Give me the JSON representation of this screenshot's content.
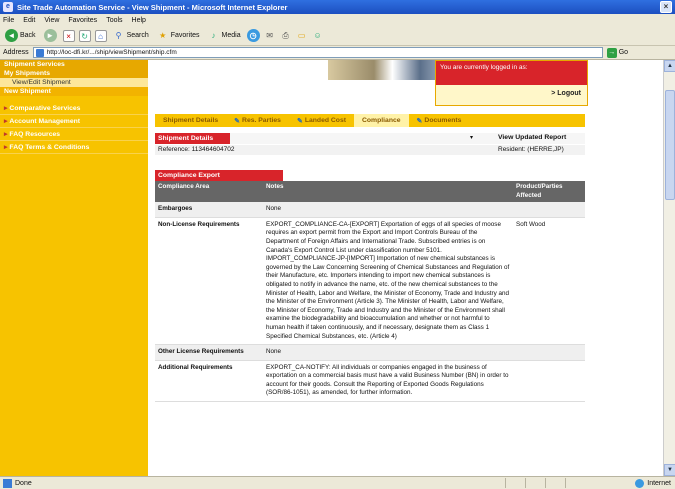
{
  "window": {
    "title": "Site Trade Automation Service - View Shipment - Microsoft Internet Explorer",
    "menu": [
      "File",
      "Edit",
      "View",
      "Favorites",
      "Tools",
      "Help"
    ],
    "toolbar": {
      "back": "Back",
      "search": "Search",
      "favorites": "Favorites",
      "media": "Media"
    },
    "address_label": "Address",
    "address_url": "http://loc-dfi.kr/.../ship/viewShipment/ship.cfm",
    "go_label": "Go",
    "status_text": "Done",
    "zone_text": "Internet"
  },
  "sidebar": {
    "section_title": "Shipment Services",
    "my_shipments": "My Shipments",
    "view_edit": "View/Edit Shipment",
    "new_shipment": "New Shipment",
    "items": [
      "Comparative Services",
      "Account Management",
      "FAQ Resources",
      "FAQ Terms & Conditions"
    ]
  },
  "login": {
    "message": "You are currently logged in as:",
    "logout": "> Logout"
  },
  "tabs": [
    {
      "label": "Shipment Details",
      "pen": false,
      "active": false
    },
    {
      "label": "Res. Parties",
      "pen": true,
      "active": false
    },
    {
      "label": "Landed Cost",
      "pen": true,
      "active": false
    },
    {
      "label": "Compliance",
      "pen": false,
      "active": true
    },
    {
      "label": "Documents",
      "pen": true,
      "active": false
    }
  ],
  "shipment": {
    "header": "Shipment Details",
    "view_report": "View Updated Report",
    "reference_label": "Reference:",
    "reference_value": "113464604702",
    "resident_label": "Resident:",
    "resident_value": "(HERRE,JP)"
  },
  "compliance": {
    "header": "Compliance Export",
    "columns": [
      "Compliance Area",
      "Notes",
      "Product/Parties Affected"
    ],
    "rows": [
      {
        "area": "Embargoes",
        "notes": [
          "None"
        ],
        "affected": ""
      },
      {
        "area": "Non-License Requirements",
        "notes": [
          "EXPORT_COMPLIANCE-CA-[EXPORT] Exportation of eggs of all species of moose requires an export permit from the Export and Import Controls Bureau of the Department of Foreign Affairs and International Trade. Subscribed entries is on Canada's Export Control List under classification number 5101.",
          "IMPORT_COMPLIANCE-JP-[IMPORT] Importation of new chemical substances is governed by the Law Concerning Screening of Chemical Substances and Regulation of their Manufacture, etc. Importers intending to import new chemical substances is obligated to notify in advance the name, etc. of the new chemical substances to the Minister of Health, Labor and Welfare, the Minister of Economy, Trade and Industry and the Minister of the Environment (Article 3). The Minister of Health, Labor and Welfare, the Minister of Economy, Trade and Industry and the Minister of the Environment shall examine the biodegradability and bioaccumulation and whether or not harmful to human health if taken continuously, and if necessary, designate them as Class 1 Specified Chemical Substances, etc. (Article 4)"
        ],
        "affected": "Soft Wood"
      },
      {
        "area": "Other License Requirements",
        "notes": [
          "None"
        ],
        "affected": ""
      },
      {
        "area": "Additional Requirements",
        "notes": [
          "EXPORT_CA-NOTIFY: All individuals or companies engaged in the business of exportation on a commercial basis must have a valid Business Number (BN) in order to account for their goods. Consult the Reporting of Exported Goods Regulations (SOR/86-1051), as amended, for further information."
        ],
        "affected": ""
      }
    ]
  }
}
